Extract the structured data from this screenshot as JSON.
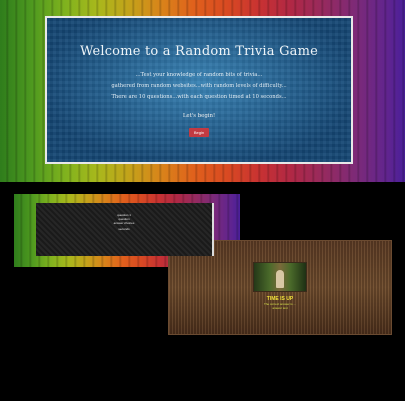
{
  "hero": {
    "title": "Welcome to a Random Trivia Game",
    "lines": [
      "...Test your knowledge of random bits of trivia...",
      "gathered from random websites...with random levels of difficulty...",
      "There are 10 questions...with each question timed at 10 seconds..."
    ],
    "lets_begin": "Let's begin!",
    "begin_button": "Begin"
  },
  "quiz": {
    "question_lines": [
      "question 1",
      "question",
      "answer choices"
    ],
    "timer": "seconds"
  },
  "result": {
    "time_up": "TIME IS UP",
    "answer_lines": [
      "The correct answer is ...",
      "answer text"
    ]
  }
}
